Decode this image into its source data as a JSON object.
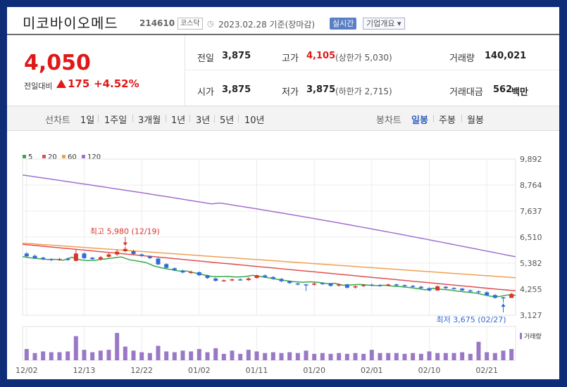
{
  "header": {
    "name": "미코바이오메드",
    "code": "214610",
    "market": "코스닥",
    "date": "2023.02.28",
    "basis": "기준(장마감)",
    "realtime": "실시간",
    "overview": "기업개요 ▾"
  },
  "quote": {
    "price": "4,050",
    "change_label": "전일대비",
    "change": "175",
    "change_pct": "+4.52%"
  },
  "stats": {
    "prev_label": "전일",
    "prev": "3,875",
    "high_label": "고가",
    "high": "4,105",
    "upper_limit": "(상한가 5,030)",
    "volume_label": "거래량",
    "volume": "140,021",
    "open_label": "시가",
    "open": "3,875",
    "low_label": "저가",
    "low": "3,875",
    "lower_limit": "(하한가 2,715)",
    "amount_label": "거래대금",
    "amount": "562",
    "amount_unit": "백만"
  },
  "period": {
    "line_label": "선차트",
    "line_tabs": [
      "1일",
      "1주일",
      "3개월",
      "1년",
      "3년",
      "5년",
      "10년"
    ],
    "candle_label": "봉차트",
    "candle_tabs": [
      "일봉",
      "주봉",
      "월봉"
    ],
    "selected": "일봉"
  },
  "chart_data": {
    "type": "candlestick",
    "legend": [
      {
        "name": "5",
        "color": "#3aa84a"
      },
      {
        "name": "20",
        "color": "#e05050"
      },
      {
        "name": "60",
        "color": "#f0a050"
      },
      {
        "name": "120",
        "color": "#a070d0"
      }
    ],
    "y_ticks": [
      "9,892",
      "8,764",
      "7,637",
      "6,510",
      "5,382",
      "4,255",
      "3,127"
    ],
    "y_tick_values": [
      9892,
      8764,
      7637,
      6510,
      5382,
      4255,
      3127
    ],
    "x_ticks": [
      "12/02",
      "12/13",
      "12/22",
      "01/02",
      "01/11",
      "01/20",
      "02/01",
      "02/10",
      "02/21"
    ],
    "x_tick_index": [
      0,
      7,
      14,
      21,
      28,
      35,
      42,
      49,
      56
    ],
    "candles": [
      [
        5800,
        5680,
        5620,
        5860
      ],
      [
        5700,
        5600,
        5560,
        5760
      ],
      [
        5620,
        5560,
        5500,
        5660
      ],
      [
        5560,
        5520,
        5470,
        5600
      ],
      [
        5520,
        5560,
        5480,
        5620
      ],
      [
        5580,
        5520,
        5480,
        5620
      ],
      [
        5480,
        5800,
        5460,
        5980
      ],
      [
        5800,
        5600,
        5560,
        5850
      ],
      [
        5620,
        5560,
        5520,
        5650
      ],
      [
        5560,
        5640,
        5500,
        5700
      ],
      [
        5660,
        5760,
        5620,
        5820
      ],
      [
        5760,
        5880,
        5700,
        5980
      ],
      [
        5900,
        6000,
        5850,
        6100
      ],
      [
        5900,
        5780,
        5720,
        5960
      ],
      [
        5760,
        5700,
        5650,
        5800
      ],
      [
        5680,
        5600,
        5560,
        5720
      ],
      [
        5580,
        5330,
        5300,
        5620
      ],
      [
        5340,
        5180,
        5150,
        5380
      ],
      [
        5160,
        5080,
        5040,
        5200
      ],
      [
        5060,
        4980,
        4940,
        5100
      ],
      [
        4960,
        5000,
        4920,
        5060
      ],
      [
        4990,
        4860,
        4820,
        5020
      ],
      [
        4860,
        4740,
        4700,
        4880
      ],
      [
        4720,
        4620,
        4580,
        4760
      ],
      [
        4620,
        4640,
        4580,
        4680
      ],
      [
        4640,
        4680,
        4600,
        4720
      ],
      [
        4680,
        4660,
        4620,
        4730
      ],
      [
        4650,
        4720,
        4610,
        4780
      ],
      [
        4740,
        4860,
        4720,
        4880
      ],
      [
        4850,
        4780,
        4740,
        4900
      ],
      [
        4780,
        4700,
        4660,
        4820
      ],
      [
        4700,
        4600,
        4560,
        4740
      ],
      [
        4600,
        4520,
        4480,
        4630
      ],
      [
        4500,
        4460,
        4420,
        4540
      ],
      [
        4460,
        4440,
        4180,
        4480
      ],
      [
        4450,
        4500,
        4400,
        4560
      ],
      [
        4520,
        4480,
        4440,
        4560
      ],
      [
        4490,
        4400,
        4360,
        4520
      ],
      [
        4410,
        4460,
        4360,
        4500
      ],
      [
        4460,
        4320,
        4280,
        4490
      ],
      [
        4330,
        4380,
        4280,
        4420
      ],
      [
        4390,
        4440,
        4350,
        4480
      ],
      [
        4450,
        4420,
        4380,
        4500
      ],
      [
        4430,
        4400,
        4360,
        4470
      ],
      [
        4410,
        4460,
        4380,
        4500
      ],
      [
        4460,
        4420,
        4380,
        4500
      ],
      [
        4430,
        4400,
        4360,
        4460
      ],
      [
        4400,
        4360,
        4320,
        4440
      ],
      [
        4360,
        4300,
        4260,
        4400
      ],
      [
        4300,
        4200,
        4160,
        4340
      ],
      [
        4200,
        4380,
        4180,
        4420
      ],
      [
        4360,
        4300,
        4260,
        4390
      ],
      [
        4310,
        4280,
        4240,
        4340
      ],
      [
        4280,
        4200,
        4180,
        4320
      ],
      [
        4200,
        4160,
        4100,
        4240
      ],
      [
        4160,
        4120,
        4080,
        4200
      ],
      [
        4120,
        4000,
        3960,
        4160
      ],
      [
        4000,
        3880,
        3840,
        4040
      ],
      [
        3900,
        3880,
        3675,
        3920
      ],
      [
        3875,
        4050,
        3875,
        4105
      ]
    ],
    "ma_series": {
      "120": {
        "color": "#a070d0",
        "start": 9200,
        "end": 5650
      },
      "60": {
        "color": "#f0a050",
        "start": 6250,
        "end": 4750
      },
      "20": {
        "color": "#e05050",
        "start": 6200,
        "end": 4180
      },
      "5": {
        "color": "#3aa84a",
        "start": 5650,
        "end": 3930
      }
    },
    "volume": [
      28,
      18,
      22,
      20,
      20,
      22,
      60,
      26,
      20,
      24,
      26,
      68,
      34,
      24,
      20,
      18,
      36,
      22,
      20,
      24,
      22,
      28,
      20,
      30,
      16,
      24,
      16,
      26,
      22,
      18,
      20,
      18,
      20,
      18,
      24,
      16,
      18,
      16,
      18,
      16,
      18,
      16,
      26,
      18,
      18,
      18,
      16,
      18,
      16,
      22,
      18,
      18,
      18,
      20,
      16,
      46,
      20,
      18,
      24,
      28
    ],
    "volume_label": "거래량",
    "annot_high": "최고 5,980 (12/19)",
    "annot_low": "최저 3,675 (02/27)"
  }
}
